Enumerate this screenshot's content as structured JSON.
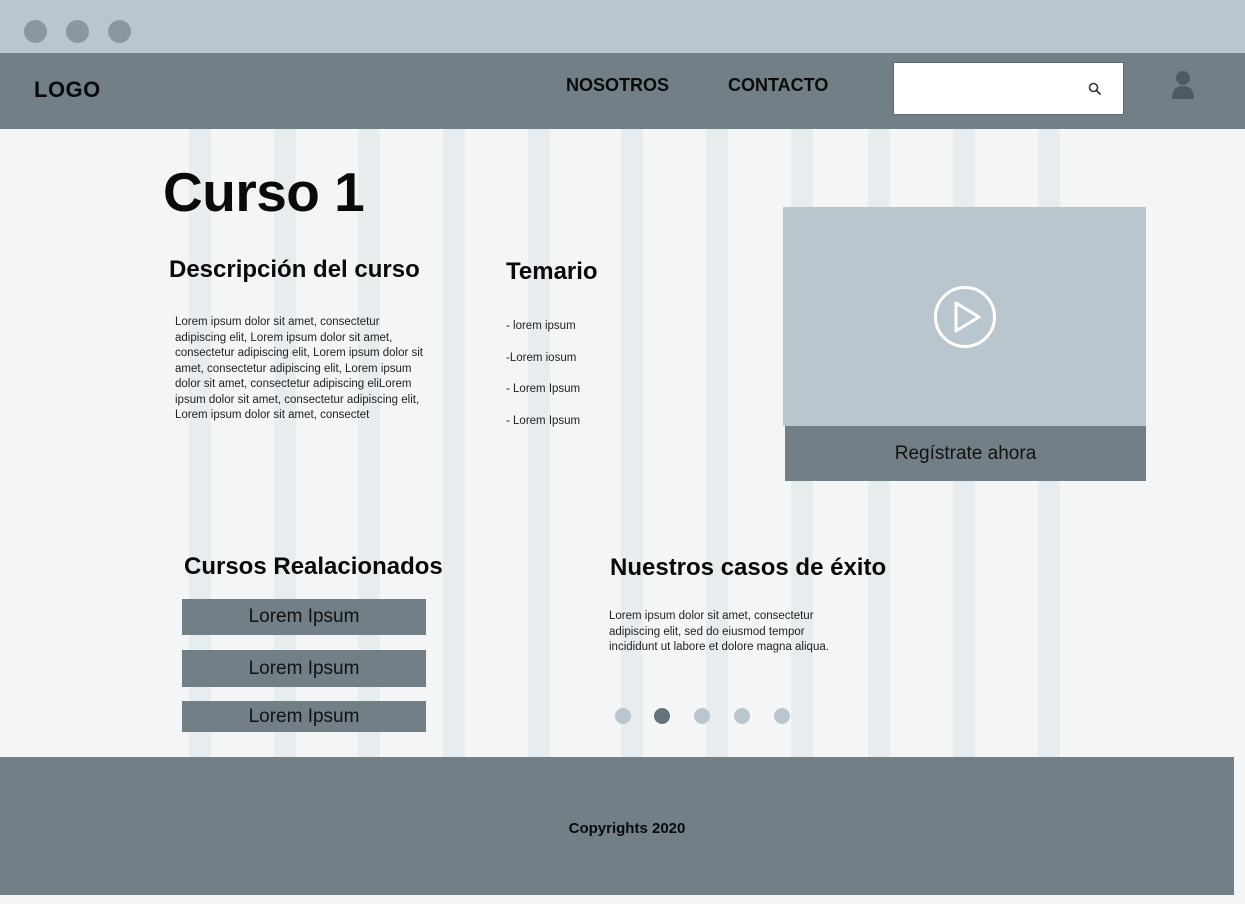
{
  "header": {
    "logo": "LOGO",
    "nav": [
      {
        "label": "NOSOTROS"
      },
      {
        "label": "CONTACTO"
      }
    ],
    "search": {
      "value": "",
      "placeholder": "",
      "icon": "search-icon"
    },
    "user_icon": "user-icon"
  },
  "course": {
    "title": "Curso 1",
    "description": {
      "heading": "Descripción del curso",
      "text": "Lorem ipsum dolor sit amet, consectetur adipiscing elit, Lorem ipsum dolor sit amet, consectetur adipiscing elit, Lorem ipsum dolor sit amet, consectetur adipiscing elit, Lorem ipsum dolor sit amet, consectetur adipiscing eliLorem ipsum dolor sit amet, consectetur adipiscing elit, Lorem ipsum dolor sit amet, consectet"
    },
    "temario": {
      "heading": "Temario",
      "items": [
        "- lorem ipsum",
        "-Lorem iosum",
        "- Lorem Ipsum",
        "- Lorem Ipsum"
      ]
    },
    "video": {
      "icon": "play-icon"
    },
    "register_label": "Regístrate ahora"
  },
  "related": {
    "heading": "Cursos Realacionados",
    "items": [
      "Lorem Ipsum",
      "Lorem Ipsum",
      "Lorem Ipsum"
    ]
  },
  "success": {
    "heading": "Nuestros casos de éxito",
    "text": "Lorem ipsum dolor sit amet, consectetur adipiscing elit, sed do eiusmod tempor incididunt ut labore et dolore magna aliqua.",
    "carousel": {
      "count": 5,
      "active_index": 1
    }
  },
  "footer": {
    "copyright": "Copyrights 2020"
  },
  "colors": {
    "chrome": "#bac6cd",
    "header": "#727f87",
    "page_bg": "#f3f5f7",
    "stripe": "#e7ecef",
    "placeholder": "#bac6cd",
    "dot_active": "#66737b"
  }
}
